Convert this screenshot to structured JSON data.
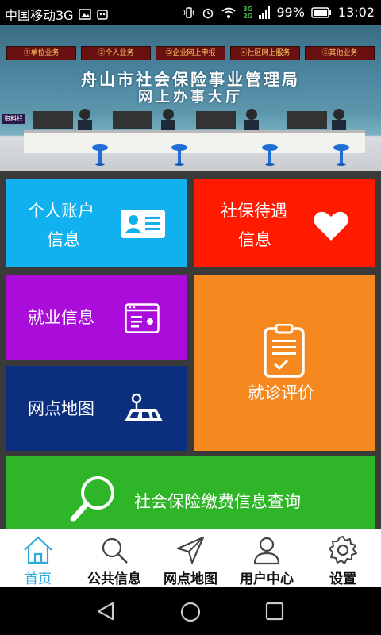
{
  "status_bar": {
    "carrier": "中国移动3G",
    "network_badge_top": "3G",
    "network_badge_bottom": "2G",
    "battery": "99%",
    "time": "13:02"
  },
  "banner": {
    "signs": [
      "①单位业务",
      "②个人业务",
      "③企业网上申报",
      "④社区网上服务",
      "⑤其他业务"
    ],
    "title_line1": "舟山市社会保险事业管理局",
    "title_line2": "网上办事大厅",
    "side_sign": "资料栏",
    "active_dot": 2
  },
  "tiles": {
    "personal_account": {
      "line1": "个人账户",
      "line2": "信息",
      "color": "#11b1f0"
    },
    "social_benefits": {
      "line1": "社保待遇",
      "line2": "信息",
      "color": "#ff1a00"
    },
    "employment": {
      "label": "就业信息",
      "color": "#aa0dd9"
    },
    "outlet_map": {
      "label": "网点地图",
      "color": "#0b2f7e"
    },
    "clinic_review": {
      "label": "就诊评价",
      "color": "#f5891f"
    },
    "payment_query": {
      "label": "社会保险缴费信息查询",
      "color": "#2fb628"
    }
  },
  "bottom_nav": [
    {
      "label": "首页",
      "icon": "home-icon",
      "active": true
    },
    {
      "label": "公共信息",
      "icon": "search-icon",
      "active": false
    },
    {
      "label": "网点地图",
      "icon": "send-icon",
      "active": false
    },
    {
      "label": "用户中心",
      "icon": "user-icon",
      "active": false
    },
    {
      "label": "设置",
      "icon": "gear-icon",
      "active": false
    }
  ],
  "colors": {
    "accent": "#2eaadc",
    "background": "#3a3a3a"
  }
}
